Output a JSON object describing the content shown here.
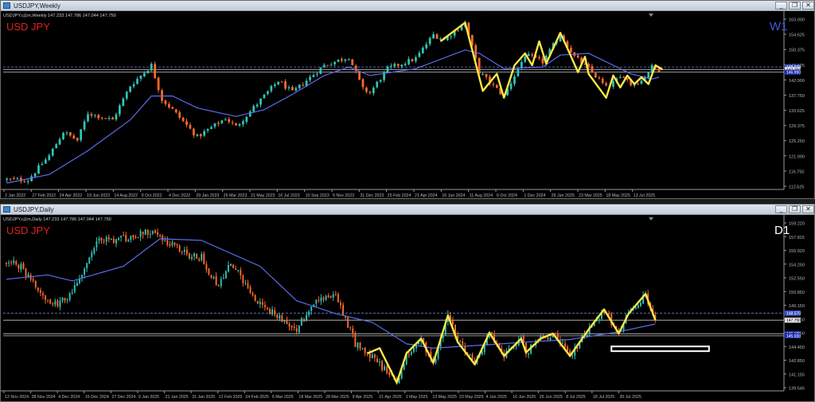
{
  "windows": [
    {
      "id": "weekly",
      "title": "USDJPY,Weekly",
      "info_line": "USDJPY.cj1m,Weekly  147.233 147.786 147.044 147.750",
      "symbol_label": "USD JPY",
      "timeframe_label": "W1",
      "price_ticks": [
        "163.000",
        "154.625",
        "150.375",
        "146.125",
        "142.000",
        "137.750",
        "133.625",
        "129.375",
        "125.250",
        "121.000",
        "116.750",
        "112.625"
      ],
      "price_tags": [
        "148.520",
        "147.750",
        "146.990"
      ],
      "date_labels": [
        "2 Jan 2022",
        "27 Feb 2022",
        "24 Apr 2022",
        "19 Jun 2022",
        "14 Aug 2022",
        "9 Oct 2022",
        "4 Dec 2022",
        "29 Jan 2023",
        "26 Mar 2023",
        "21 May 2023",
        "16 Jul 2023",
        "10 Sep 2023",
        "5 Nov 2023",
        "31 Dec 2023",
        "25 Feb 2024",
        "21 Apr 2024",
        "16 Jun 2024",
        "11 Aug 2024",
        "6 Oct 2024",
        "1 Dec 2024",
        "26 Jan 2025",
        "23 Mar 2025",
        "18 May 2025",
        "13 Jul 2025"
      ]
    },
    {
      "id": "daily",
      "title": "USDJPY,Daily",
      "info_line": "USDJPY.cj1m,Daily  147.233 147.786 147.044 147.750",
      "symbol_label": "USD JPY",
      "timeframe_label": "D1",
      "price_ticks": [
        "159.220",
        "157.815",
        "155.920",
        "154.250",
        "152.550",
        "150.850",
        "149.150",
        "147.450",
        "145.750",
        "144.450",
        "142.850",
        "141.155",
        "139.545"
      ],
      "price_tags": [
        "148.570",
        "147.750",
        "146.180",
        "145.930"
      ],
      "date_labels": [
        "12 Nov 2024",
        "28 Nov 2024",
        "4 Dec 2024",
        "16 Dec 2024",
        "27 Dec 2024",
        "9 Jan 2025",
        "21 Jan 2025",
        "31 Jan 2025",
        "12 Feb 2025",
        "24 Feb 2025",
        "6 Mar 2025",
        "18 Mar 2025",
        "28 Mar 2025",
        "9 Apr 2025",
        "21 Apr 2025",
        "1 May 2025",
        "13 May 2025",
        "23 May 2025",
        "4 Jun 2025",
        "16 Jun 2025",
        "26 Jun 2025",
        "8 Jul 2025",
        "18 Jul 2025",
        "30 Jul 2025"
      ]
    }
  ],
  "colors": {
    "background": "#000000",
    "bull": "#2ec4b6",
    "bear": "#ff6a2a",
    "moving_average": "#5b6cf0",
    "zigzag": "#f7e74a",
    "symbol_label": "#e0201f",
    "weekly_timeframe_label": "#3d5bd6",
    "daily_timeframe_label": "#ffffff",
    "axis_text": "#b8b8b8"
  },
  "chart_data": [
    {
      "type": "candlestick",
      "window": "weekly",
      "symbol": "USD JPY",
      "timeframe": "W1",
      "ylim": [
        112.625,
        163.0
      ],
      "x_range": [
        "2 Jan 2022",
        "13 Jul 2025"
      ],
      "grid": false,
      "last_price": 147.75,
      "ohlc_last": {
        "open": 147.233,
        "high": 147.786,
        "low": 147.044,
        "close": 147.75
      },
      "close_path": [
        {
          "x": "3 Jan 2022",
          "y": 115.5
        },
        {
          "x": "14 Feb 2022",
          "y": 115.4
        },
        {
          "x": "7 Mar 2022",
          "y": 119.0
        },
        {
          "x": "28 Mar 2022",
          "y": 122.5
        },
        {
          "x": "25 Apr 2022",
          "y": 129.5
        },
        {
          "x": "23 May 2022",
          "y": 127.0
        },
        {
          "x": "13 Jun 2022",
          "y": 135.0
        },
        {
          "x": "1 Aug 2022",
          "y": 133.0
        },
        {
          "x": "5 Sep 2022",
          "y": 143.0
        },
        {
          "x": "17 Oct 2022",
          "y": 149.0
        },
        {
          "x": "7 Nov 2022",
          "y": 139.0
        },
        {
          "x": "28 Nov 2022",
          "y": 136.0
        },
        {
          "x": "16 Jan 2023",
          "y": 128.0
        },
        {
          "x": "13 Mar 2023",
          "y": 133.5
        },
        {
          "x": "3 Apr 2023",
          "y": 131.0
        },
        {
          "x": "29 May 2023",
          "y": 140.0
        },
        {
          "x": "26 Jun 2023",
          "y": 144.5
        },
        {
          "x": "24 Jul 2023",
          "y": 141.0
        },
        {
          "x": "25 Sep 2023",
          "y": 149.0
        },
        {
          "x": "13 Nov 2023",
          "y": 151.5
        },
        {
          "x": "11 Dec 2023",
          "y": 142.0
        },
        {
          "x": "25 Dec 2023",
          "y": 141.0
        },
        {
          "x": "29 Jan 2024",
          "y": 148.0
        },
        {
          "x": "25 Mar 2024",
          "y": 151.0
        },
        {
          "x": "29 Apr 2024",
          "y": 158.0
        },
        {
          "x": "20 May 2024",
          "y": 156.5
        },
        {
          "x": "1 Jul 2024",
          "y": 161.5
        },
        {
          "x": "29 Jul 2024",
          "y": 147.0
        },
        {
          "x": "16 Sep 2024",
          "y": 140.0
        },
        {
          "x": "28 Oct 2024",
          "y": 152.0
        },
        {
          "x": "2 Dec 2024",
          "y": 150.0
        },
        {
          "x": "6 Jan 2025",
          "y": 158.0
        },
        {
          "x": "3 Feb 2025",
          "y": 151.5
        },
        {
          "x": "3 Mar 2025",
          "y": 148.0
        },
        {
          "x": "7 Apr 2025",
          "y": 142.5
        },
        {
          "x": "12 May 2025",
          "y": 146.0
        },
        {
          "x": "26 May 2025",
          "y": 143.5
        },
        {
          "x": "16 Jun 2025",
          "y": 144.5
        },
        {
          "x": "7 Jul 2025",
          "y": 148.5
        },
        {
          "x": "21 Jul 2025",
          "y": 147.75
        }
      ],
      "moving_average_path": [
        {
          "x": "3 Jan 2022",
          "y": 114.5
        },
        {
          "x": "28 Mar 2022",
          "y": 117.0
        },
        {
          "x": "13 Jun 2022",
          "y": 124.0
        },
        {
          "x": "5 Sep 2022",
          "y": 133.0
        },
        {
          "x": "17 Oct 2022",
          "y": 140.0
        },
        {
          "x": "28 Nov 2022",
          "y": 140.0
        },
        {
          "x": "16 Jan 2023",
          "y": 136.5
        },
        {
          "x": "3 Apr 2023",
          "y": 134.0
        },
        {
          "x": "29 May 2023",
          "y": 136.0
        },
        {
          "x": "24 Jul 2023",
          "y": 140.5
        },
        {
          "x": "25 Sep 2023",
          "y": 146.0
        },
        {
          "x": "13 Nov 2023",
          "y": 148.5
        },
        {
          "x": "25 Dec 2023",
          "y": 146.0
        },
        {
          "x": "25 Mar 2024",
          "y": 148.0
        },
        {
          "x": "1 Jul 2024",
          "y": 153.5
        },
        {
          "x": "29 Jul 2024",
          "y": 152.5
        },
        {
          "x": "16 Sep 2024",
          "y": 148.0
        },
        {
          "x": "2 Dec 2024",
          "y": 148.5
        },
        {
          "x": "6 Jan 2025",
          "y": 152.0
        },
        {
          "x": "3 Mar 2025",
          "y": 152.5
        },
        {
          "x": "7 Apr 2025",
          "y": 150.0
        },
        {
          "x": "26 May 2025",
          "y": 146.5
        },
        {
          "x": "7 Jul 2025",
          "y": 145.0
        },
        {
          "x": "21 Jul 2025",
          "y": 145.5
        }
      ],
      "zigzag": [
        {
          "x": "13 May 2024",
          "y": 156.0
        },
        {
          "x": "1 Jul 2024",
          "y": 161.5
        },
        {
          "x": "5 Aug 2024",
          "y": 141.5
        },
        {
          "x": "2 Sep 2024",
          "y": 146.5
        },
        {
          "x": "16 Sep 2024",
          "y": 139.5
        },
        {
          "x": "7 Oct 2024",
          "y": 149.0
        },
        {
          "x": "28 Oct 2024",
          "y": 152.5
        },
        {
          "x": "11 Nov 2024",
          "y": 149.0
        },
        {
          "x": "25 Nov 2024",
          "y": 156.0
        },
        {
          "x": "9 Dec 2024",
          "y": 149.5
        },
        {
          "x": "6 Jan 2025",
          "y": 158.5
        },
        {
          "x": "20 Jan 2025",
          "y": 154.0
        },
        {
          "x": "10 Feb 2025",
          "y": 147.0
        },
        {
          "x": "24 Feb 2025",
          "y": 151.5
        },
        {
          "x": "3 Mar 2025",
          "y": 146.5
        },
        {
          "x": "7 Apr 2025",
          "y": 139.5
        },
        {
          "x": "21 Apr 2025",
          "y": 146.0
        },
        {
          "x": "5 May 2025",
          "y": 142.5
        },
        {
          "x": "19 May 2025",
          "y": 146.0
        },
        {
          "x": "2 Jun 2025",
          "y": 143.5
        },
        {
          "x": "16 Jun 2025",
          "y": 145.5
        },
        {
          "x": "30 Jun 2025",
          "y": 143.5
        },
        {
          "x": "14 Jul 2025",
          "y": 149.0
        },
        {
          "x": "28 Jul 2025",
          "y": 147.75
        }
      ],
      "price_levels": [
        148.52,
        147.75,
        146.99
      ]
    },
    {
      "type": "candlestick",
      "window": "daily",
      "symbol": "USD JPY",
      "timeframe": "D1",
      "ylim": [
        139.545,
        159.22
      ],
      "x_range": [
        "12 Nov 2024",
        "30 Jul 2025"
      ],
      "grid": false,
      "last_price": 147.75,
      "ohlc_last": {
        "open": 147.233,
        "high": 147.786,
        "low": 147.044,
        "close": 147.75
      },
      "close_path": [
        {
          "x": "12 Nov 2024",
          "y": 154.5
        },
        {
          "x": "18 Nov 2024",
          "y": 154.0
        },
        {
          "x": "29 Nov 2024",
          "y": 149.8
        },
        {
          "x": "3 Dec 2024",
          "y": 149.5
        },
        {
          "x": "9 Dec 2024",
          "y": 151.0
        },
        {
          "x": "20 Dec 2024",
          "y": 157.0
        },
        {
          "x": "30 Dec 2024",
          "y": 157.2
        },
        {
          "x": "10 Jan 2025",
          "y": 158.0
        },
        {
          "x": "14 Jan 2025",
          "y": 157.5
        },
        {
          "x": "24 Jan 2025",
          "y": 155.5
        },
        {
          "x": "31 Jan 2025",
          "y": 155.0
        },
        {
          "x": "7 Feb 2025",
          "y": 151.5
        },
        {
          "x": "12 Feb 2025",
          "y": 154.5
        },
        {
          "x": "24 Feb 2025",
          "y": 149.5
        },
        {
          "x": "11 Mar 2025",
          "y": 146.8
        },
        {
          "x": "18 Mar 2025",
          "y": 149.5
        },
        {
          "x": "27 Mar 2025",
          "y": 151.0
        },
        {
          "x": "4 Apr 2025",
          "y": 145.0
        },
        {
          "x": "11 Apr 2025",
          "y": 143.5
        },
        {
          "x": "21 Apr 2025",
          "y": 140.5
        },
        {
          "x": "25 Apr 2025",
          "y": 143.5
        },
        {
          "x": "1 May 2025",
          "y": 145.5
        },
        {
          "x": "6 May 2025",
          "y": 142.5
        },
        {
          "x": "12 May 2025",
          "y": 148.3
        },
        {
          "x": "16 May 2025",
          "y": 145.5
        },
        {
          "x": "23 May 2025",
          "y": 142.6
        },
        {
          "x": "29 May 2025",
          "y": 146.3
        },
        {
          "x": "4 Jun 2025",
          "y": 143.6
        },
        {
          "x": "11 Jun 2025",
          "y": 145.6
        },
        {
          "x": "13 Jun 2025",
          "y": 144.0
        },
        {
          "x": "19 Jun 2025",
          "y": 145.6
        },
        {
          "x": "24 Jun 2025",
          "y": 146.2
        },
        {
          "x": "1 Jul 2025",
          "y": 143.6
        },
        {
          "x": "9 Jul 2025",
          "y": 146.8
        },
        {
          "x": "15 Jul 2025",
          "y": 149.0
        },
        {
          "x": "21 Jul 2025",
          "y": 146.2
        },
        {
          "x": "25 Jul 2025",
          "y": 148.5
        },
        {
          "x": "1 Aug 2025",
          "y": 150.8
        },
        {
          "x": "5 Aug 2025",
          "y": 147.75
        }
      ],
      "moving_average_path": [
        {
          "x": "12 Nov 2024",
          "y": 152.5
        },
        {
          "x": "29 Nov 2024",
          "y": 153.0
        },
        {
          "x": "9 Dec 2024",
          "y": 152.3
        },
        {
          "x": "30 Dec 2024",
          "y": 154.0
        },
        {
          "x": "14 Jan 2025",
          "y": 157.2
        },
        {
          "x": "31 Jan 2025",
          "y": 157.0
        },
        {
          "x": "24 Feb 2025",
          "y": 154.0
        },
        {
          "x": "11 Mar 2025",
          "y": 150.0
        },
        {
          "x": "27 Mar 2025",
          "y": 148.5
        },
        {
          "x": "11 Apr 2025",
          "y": 147.5
        },
        {
          "x": "25 Apr 2025",
          "y": 145.0
        },
        {
          "x": "6 May 2025",
          "y": 144.5
        },
        {
          "x": "23 May 2025",
          "y": 144.8
        },
        {
          "x": "13 Jun 2025",
          "y": 145.2
        },
        {
          "x": "1 Jul 2025",
          "y": 145.5
        },
        {
          "x": "21 Jul 2025",
          "y": 146.4
        },
        {
          "x": "5 Aug 2025",
          "y": 147.3
        }
      ],
      "zigzag": [
        {
          "x": "9 Apr 2025",
          "y": 143.9
        },
        {
          "x": "14 Apr 2025",
          "y": 144.5
        },
        {
          "x": "21 Apr 2025",
          "y": 140.5
        },
        {
          "x": "25 Apr 2025",
          "y": 143.9
        },
        {
          "x": "1 May 2025",
          "y": 145.6
        },
        {
          "x": "6 May 2025",
          "y": 142.8
        },
        {
          "x": "12 May 2025",
          "y": 148.3
        },
        {
          "x": "16 May 2025",
          "y": 145.2
        },
        {
          "x": "23 May 2025",
          "y": 142.6
        },
        {
          "x": "29 May 2025",
          "y": 146.3
        },
        {
          "x": "4 Jun 2025",
          "y": 143.6
        },
        {
          "x": "11 Jun 2025",
          "y": 145.6
        },
        {
          "x": "13 Jun 2025",
          "y": 144.0
        },
        {
          "x": "19 Jun 2025",
          "y": 145.6
        },
        {
          "x": "24 Jun 2025",
          "y": 146.2
        },
        {
          "x": "1 Jul 2025",
          "y": 143.6
        },
        {
          "x": "9 Jul 2025",
          "y": 146.8
        },
        {
          "x": "15 Jul 2025",
          "y": 149.0
        },
        {
          "x": "21 Jul 2025",
          "y": 146.2
        },
        {
          "x": "25 Jul 2025",
          "y": 148.5
        },
        {
          "x": "1 Aug 2025",
          "y": 150.8
        },
        {
          "x": "5 Aug 2025",
          "y": 147.75
        }
      ],
      "price_levels": [
        148.57,
        147.75,
        146.18,
        145.93
      ],
      "highlight_zone": {
        "x_start": "18 Jul 2025",
        "x_end": "27 Aug 2025",
        "y_low": 144.15,
        "y_high": 144.7
      }
    }
  ]
}
